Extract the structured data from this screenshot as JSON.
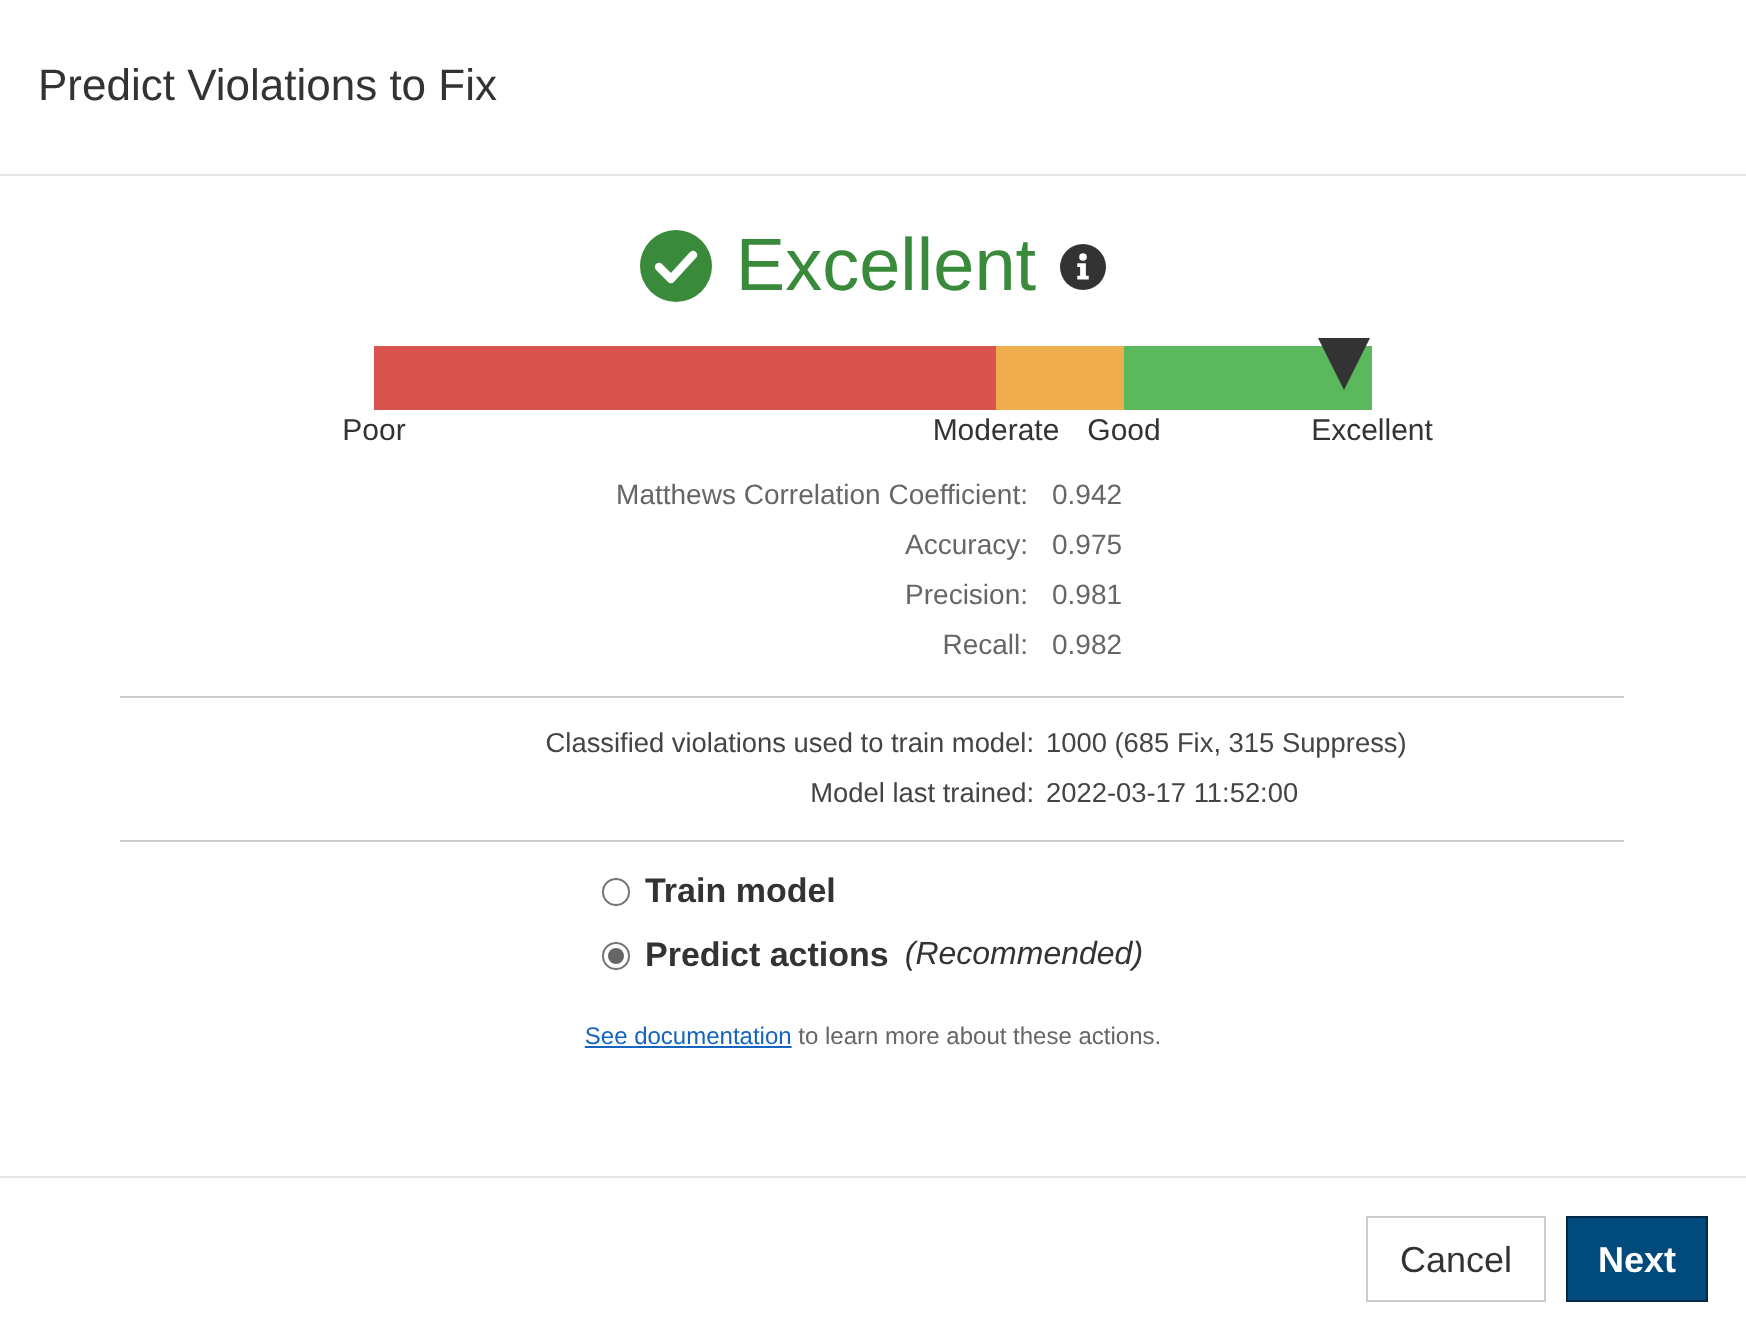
{
  "dialog": {
    "title": "Predict Violations to Fix"
  },
  "rating": {
    "label": "Excellent"
  },
  "scale": {
    "segments": [
      {
        "color": "#d9534f"
      },
      {
        "color": "#f0ad4e"
      },
      {
        "color": "#5cb85c"
      }
    ],
    "labels": [
      "Poor",
      "Moderate",
      "Good",
      "Excellent"
    ],
    "marker": {
      "level": 0.972
    }
  },
  "metrics": [
    {
      "label": "Matthews Correlation Coefficient:",
      "value": "0.942"
    },
    {
      "label": "Accuracy:",
      "value": "0.975"
    },
    {
      "label": "Precision:",
      "value": "0.981"
    },
    {
      "label": "Recall:",
      "value": "0.982"
    }
  ],
  "training": [
    {
      "label": "Classified violations used to train model:",
      "value": "1000 (685 Fix, 315 Suppress)"
    },
    {
      "label": "Model last trained:",
      "value": "2022-03-17 11:52:00"
    }
  ],
  "actions": [
    {
      "label": "Train model",
      "selected": false
    },
    {
      "label": "Predict actions",
      "note": "(Recommended)",
      "selected": true
    }
  ],
  "help": {
    "link": "See documentation",
    "text": "to learn more about these actions."
  },
  "buttons": [
    {
      "label": "Cancel",
      "kind": "secondary"
    },
    {
      "label": "Next",
      "kind": "primary"
    }
  ]
}
